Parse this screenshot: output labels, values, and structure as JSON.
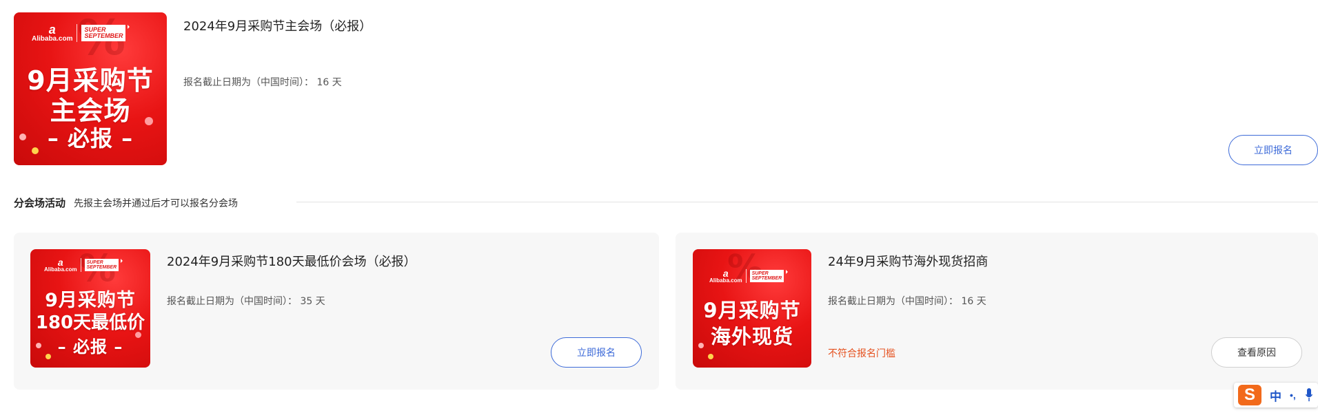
{
  "main_event": {
    "banner": {
      "brand": "Alibaba.com",
      "tag_line1": "SUPER",
      "tag_line2": "SEPTEMBER",
      "line1": "9月采购节",
      "line2": "主会场",
      "line3": "– 必报 –"
    },
    "title": "2024年9月采购节主会场（必报）",
    "deadline": "报名截止日期为（中国时间）： 16 天",
    "action_label": "立即报名"
  },
  "sub_section": {
    "heading": "分会场活动",
    "note": "先报主会场并通过后才可以报名分会场"
  },
  "sub_events": [
    {
      "banner": {
        "brand": "Alibaba.com",
        "tag_line1": "SUPER",
        "tag_line2": "SEPTEMBER",
        "line1": "9月采购节",
        "line2": "180天最低价",
        "line3": "– 必报 –"
      },
      "title": "2024年9月采购节180天最低价会场（必报）",
      "deadline": "报名截止日期为（中国时间）： 35 天",
      "action_label": "立即报名"
    },
    {
      "banner": {
        "brand": "Alibaba.com",
        "tag_line1": "SUPER",
        "tag_line2": "SEPTEMBER",
        "line1": "9月采购节",
        "line2": "海外现货"
      },
      "title": "24年9月采购节海外现货招商",
      "deadline": "报名截止日期为（中国时间）： 16 天",
      "status": "不符合报名门槛",
      "action_label": "查看原因"
    }
  ],
  "ime": {
    "logo": "S",
    "mode": "中",
    "punct": "•,"
  },
  "colors": {
    "brand_red": "#e81414",
    "primary_blue": "#3c6ad8",
    "warning_orange": "#e5511f"
  }
}
